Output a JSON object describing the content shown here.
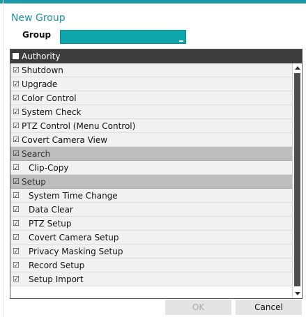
{
  "dialog": {
    "title": "New Group",
    "group_label": "Group",
    "group_value": ""
  },
  "list": {
    "header": "Authority",
    "check_glyph": "☑",
    "rows": [
      {
        "label": "Shutdown",
        "type": "item",
        "level": 0
      },
      {
        "label": "Upgrade",
        "type": "item",
        "level": 0
      },
      {
        "label": "Color Control",
        "type": "item",
        "level": 0
      },
      {
        "label": "System Check",
        "type": "item",
        "level": 0
      },
      {
        "label": "PTZ Control (Menu Control)",
        "type": "item",
        "level": 0
      },
      {
        "label": "Covert Camera View",
        "type": "item",
        "level": 0
      },
      {
        "label": "Search",
        "type": "section",
        "level": 0
      },
      {
        "label": "Clip-Copy",
        "type": "item",
        "level": 1
      },
      {
        "label": "Setup",
        "type": "section",
        "level": 0
      },
      {
        "label": "System Time Change",
        "type": "item",
        "level": 1
      },
      {
        "label": "Data Clear",
        "type": "item",
        "level": 1
      },
      {
        "label": "PTZ Setup",
        "type": "item",
        "level": 1
      },
      {
        "label": "Covert Camera Setup",
        "type": "item",
        "level": 1
      },
      {
        "label": "Privacy Masking Setup",
        "type": "item",
        "level": 1
      },
      {
        "label": "Record Setup",
        "type": "item",
        "level": 1
      },
      {
        "label": "Setup Import",
        "type": "item",
        "level": 1
      }
    ]
  },
  "buttons": {
    "ok": "OK",
    "cancel": "Cancel"
  },
  "colors": {
    "accent": "#1d98a8",
    "input_fill": "#0da6ad",
    "header_bg": "#3c3c3c",
    "section_bg": "#bdbdbd",
    "row_bg": "#f1f1f1"
  }
}
